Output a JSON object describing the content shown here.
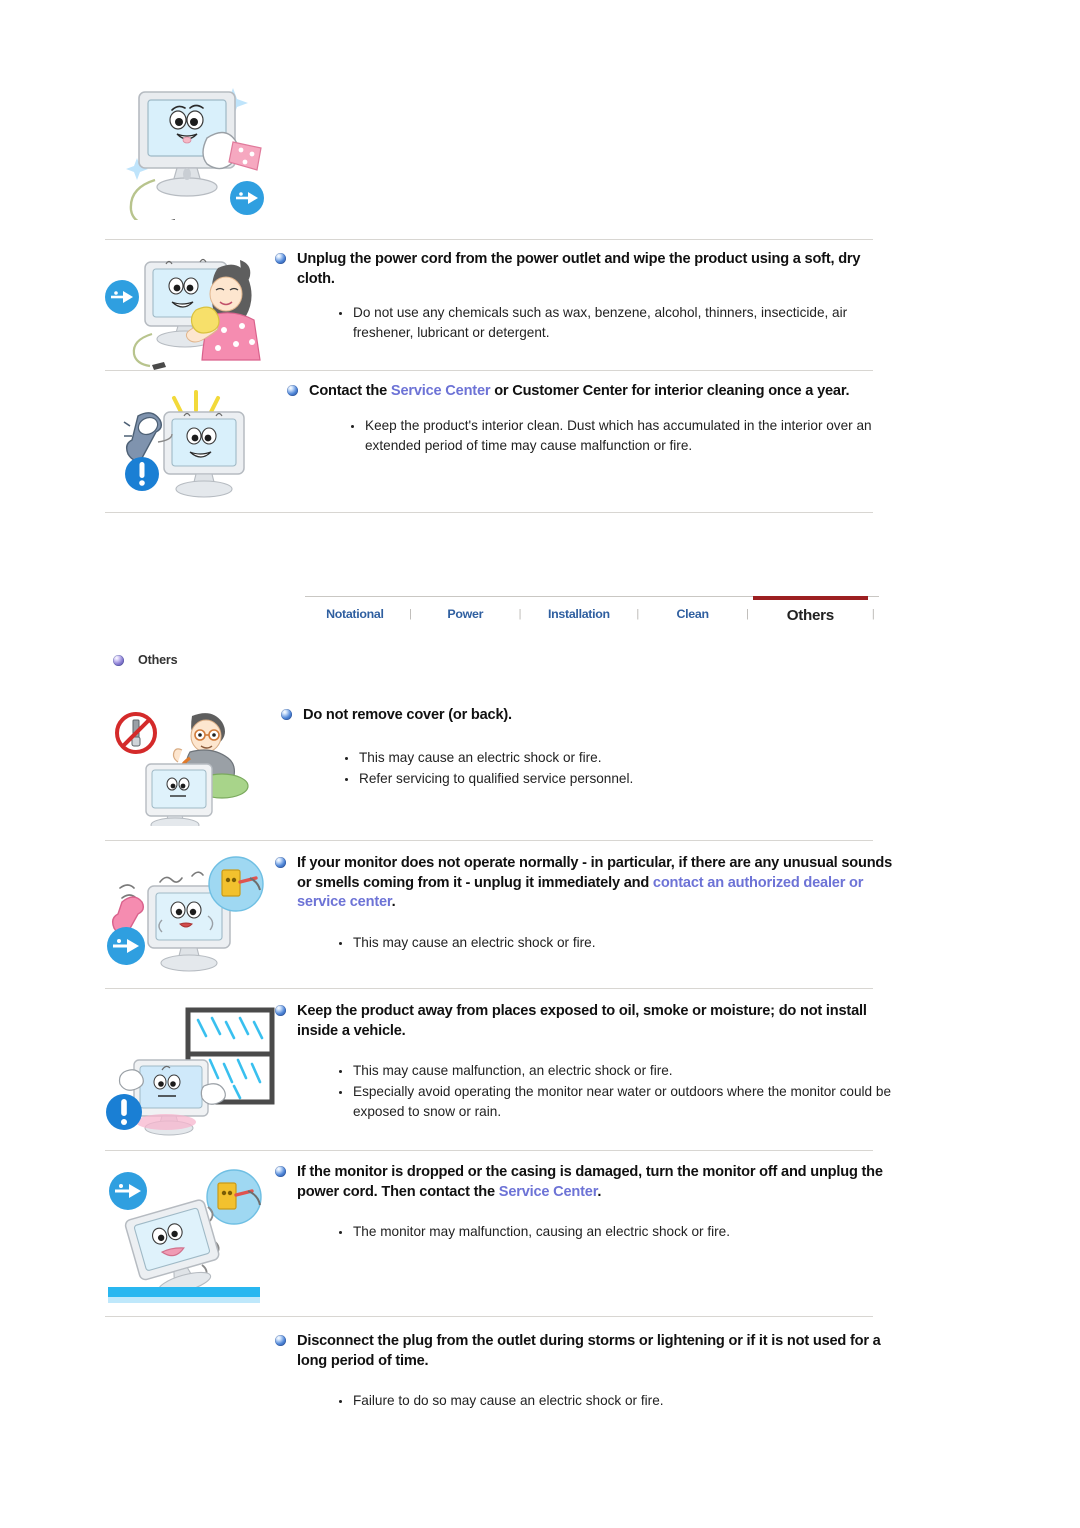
{
  "page": {
    "tab_nav": {
      "items": [
        {
          "label": "Notational",
          "active": false
        },
        {
          "label": "Power",
          "active": false
        },
        {
          "label": "Installation",
          "active": false
        },
        {
          "label": "Clean",
          "active": false
        },
        {
          "label": "Others",
          "active": true
        }
      ],
      "separator": "|",
      "active_color": "#9c1f21",
      "link_color": "#2f5fa0"
    },
    "section_label": {
      "text": "Others",
      "bullet_color": "#8b7fd4"
    },
    "colors": {
      "link": "#6d73d6",
      "heading": "#111111",
      "body": "#222222",
      "divider": "#d8d6d2",
      "bullet_sphere": "#4f86d8"
    },
    "sections": [
      {
        "id": "clean-top-image",
        "heading": null,
        "bullets": [],
        "illustration": "monitor-wiped-with-cloth"
      },
      {
        "id": "unplug-and-wipe",
        "heading_parts": [
          {
            "text": "Unplug the power cord from the power outlet and wipe the product using a soft, dry cloth.",
            "link": false
          }
        ],
        "bullets": [
          "Do not use any chemicals such as wax, benzene, alcohol, thinners, insecticide, air freshener, lubricant or detergent."
        ],
        "illustration": "woman-wiping-monitor"
      },
      {
        "id": "contact-service-center",
        "heading_parts": [
          {
            "text": "Contact the ",
            "link": false
          },
          {
            "text": "Service Center",
            "link": true
          },
          {
            "text": " or Customer Center for interior cleaning once a year.",
            "link": false
          }
        ],
        "bullets": [
          "Keep the product's interior clean. Dust which has accumulated in the interior over an extended period of time may cause malfunction or fire."
        ],
        "illustration": "monitor-with-telephone"
      },
      {
        "id": "do-not-remove-cover",
        "heading_parts": [
          {
            "text": "Do not remove cover (or back).",
            "link": false
          }
        ],
        "bullets": [
          "This may cause an electric shock or fire.",
          "Refer servicing to qualified service personnel."
        ],
        "illustration": "no-screwdriver-man-opening-monitor"
      },
      {
        "id": "abnormal-operation",
        "heading_parts": [
          {
            "text": "If your monitor does not operate normally - in particular, if there are any unusual sounds or smells coming from it - unplug it immediately and ",
            "link": false
          },
          {
            "text": "contact an authorized dealer or service center",
            "link": true
          },
          {
            "text": ".",
            "link": false
          }
        ],
        "bullets": [
          "This may cause an electric shock or fire."
        ],
        "illustration": "monitor-smoke-unplug"
      },
      {
        "id": "avoid-oil-smoke-moisture",
        "heading_parts": [
          {
            "text": "Keep the product away from places exposed to oil, smoke or moisture; do not install inside a vehicle.",
            "link": false
          }
        ],
        "bullets": [
          "This may cause malfunction, an electric shock or fire.",
          "Especially avoid operating the monitor near water or outdoors where the monitor could be exposed to snow or rain."
        ],
        "illustration": "monitor-near-rainy-window"
      },
      {
        "id": "dropped-or-damaged",
        "heading_parts": [
          {
            "text": "If the monitor is dropped or the casing is damaged, turn the monitor off and unplug the power cord. Then contact the ",
            "link": false
          },
          {
            "text": "Service Center",
            "link": true
          },
          {
            "text": ".",
            "link": false
          }
        ],
        "bullets": [
          "The monitor may malfunction, causing an electric shock or fire."
        ],
        "illustration": "monitor-dropped"
      },
      {
        "id": "disconnect-during-storms",
        "heading_parts": [
          {
            "text": "Disconnect the plug from the outlet during storms or lightening or if it is not used for a long period of time.",
            "link": false
          }
        ],
        "bullets": [
          "Failure to do so may cause an electric shock or fire."
        ],
        "illustration": null
      }
    ]
  }
}
